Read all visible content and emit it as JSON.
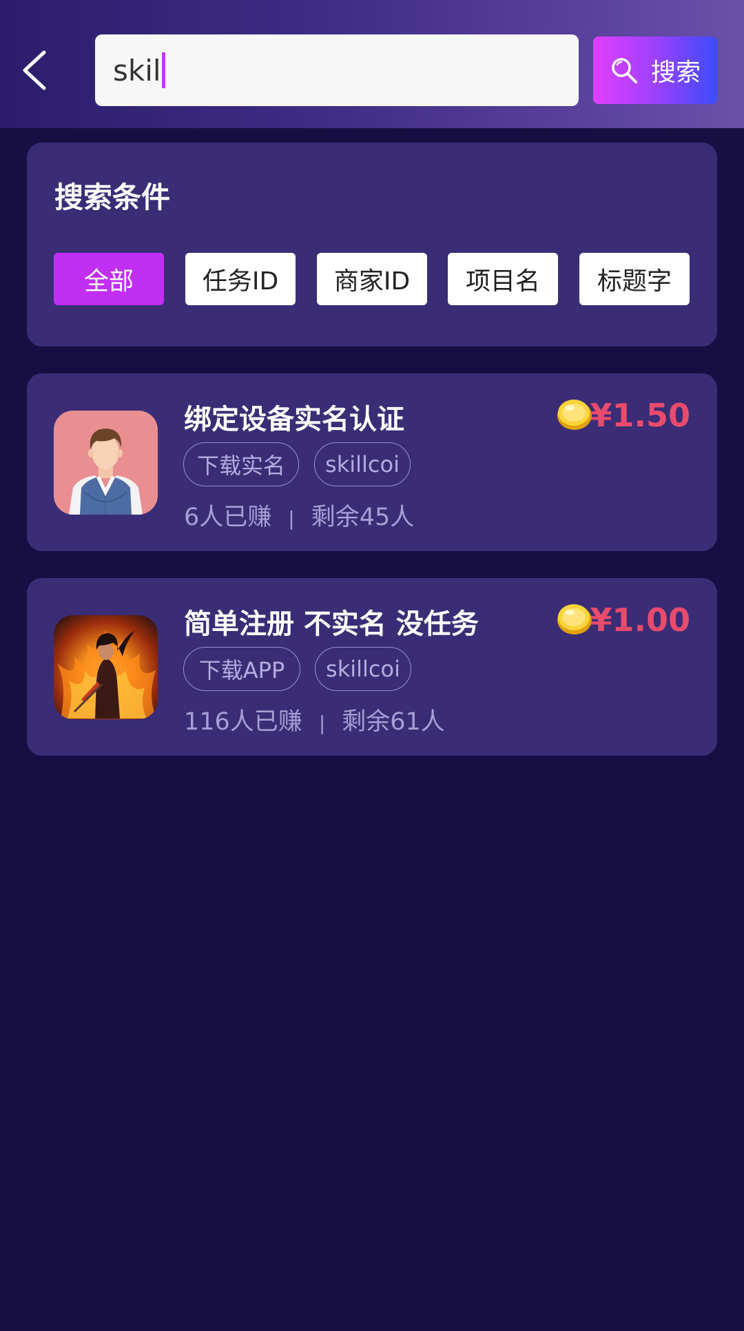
{
  "header": {
    "search_value": "skil",
    "search_button_label": "搜索"
  },
  "filter": {
    "title": "搜索条件",
    "options": [
      "全部",
      "任务ID",
      "商家ID",
      "项目名",
      "标题字"
    ],
    "selected": "全部"
  },
  "tasks": [
    {
      "title": "绑定设备实名认证",
      "tags": [
        "下载实名",
        "skillcoi"
      ],
      "earned": "6人已赚",
      "separator": "|",
      "remaining": "剩余45人",
      "price": "¥1.50",
      "avatar_icon": "person-avatar-icon"
    },
    {
      "title": "简单注册 不实名 没任务",
      "tags": [
        "下载APP",
        "skillcoi"
      ],
      "earned": "116人已赚",
      "separator": "|",
      "remaining": "剩余61人",
      "price": "¥1.00",
      "avatar_icon": "fire-warrior-avatar-icon"
    }
  ],
  "colors": {
    "background": "#170f44",
    "card": "#3a2d76",
    "accent": "#c02ff3",
    "price": "#e94b6c"
  }
}
